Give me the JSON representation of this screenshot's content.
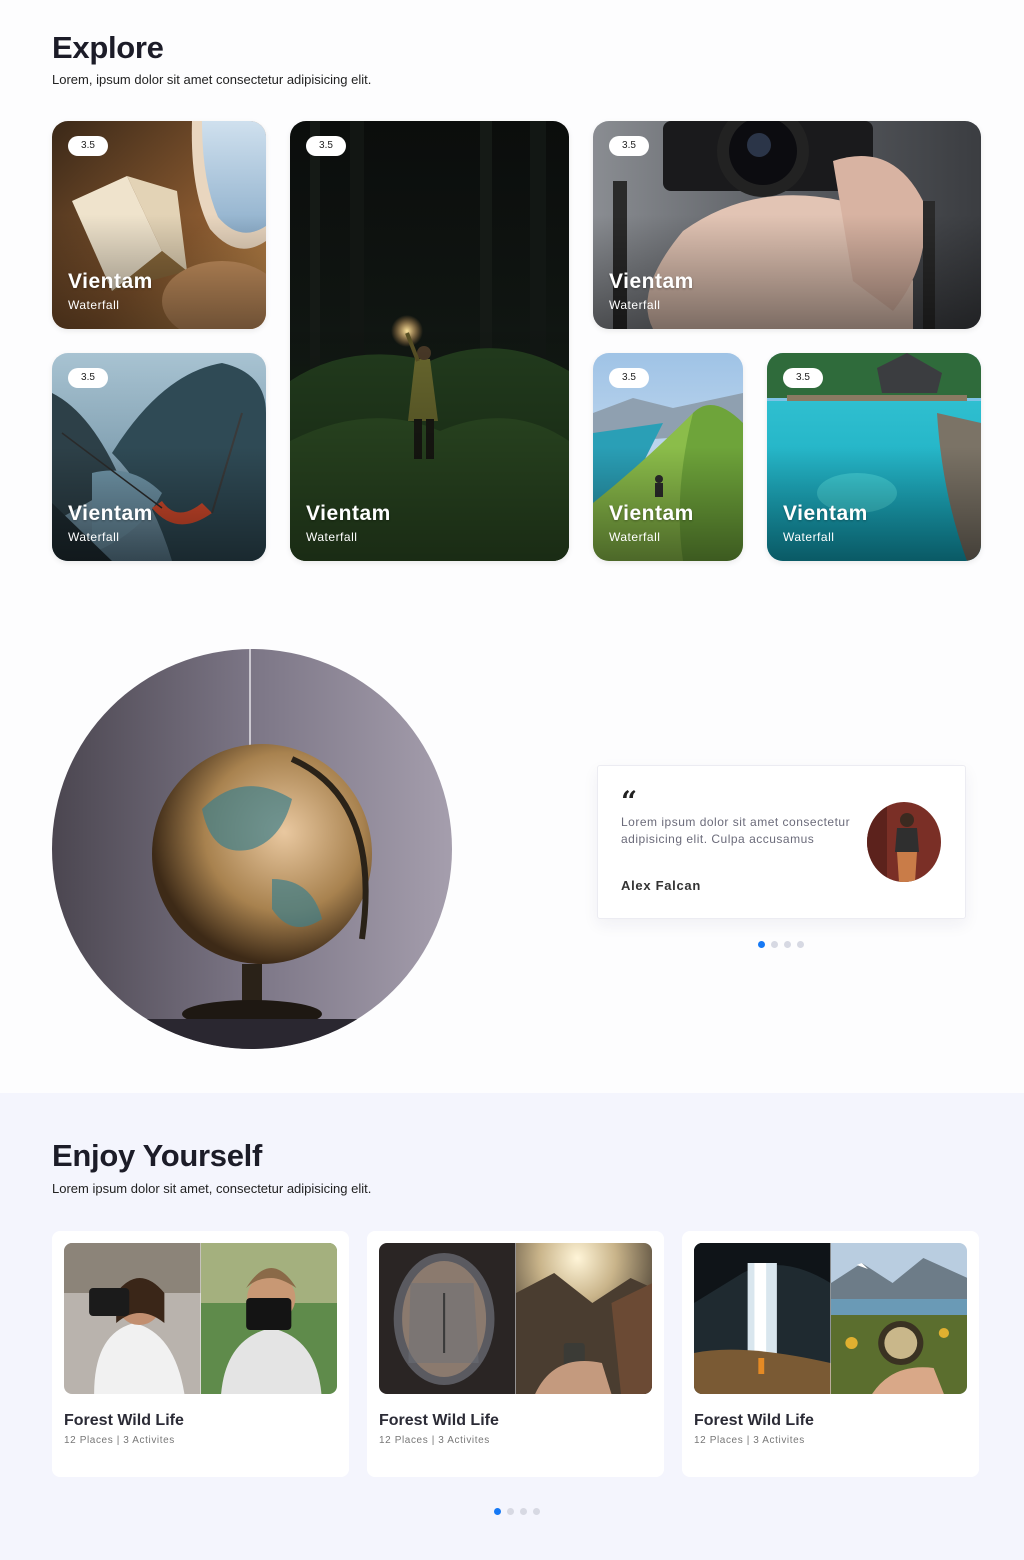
{
  "explore": {
    "title": "Explore",
    "subtitle": "Lorem, ipsum dolor sit amet consectetur adipisicing elit.",
    "cards": [
      {
        "rating": "3.5",
        "title": "Vientam",
        "subtitle": "Waterfall",
        "scene": "book-airplane-window"
      },
      {
        "rating": "3.5",
        "title": "Vientam",
        "subtitle": "Waterfall",
        "scene": "night-forest-sparkler"
      },
      {
        "rating": "3.5",
        "title": "Vientam",
        "subtitle": "Waterfall",
        "scene": "hands-camera"
      },
      {
        "rating": "3.5",
        "title": "Vientam",
        "subtitle": "Waterfall",
        "scene": "fjord-hammock"
      },
      {
        "rating": "3.5",
        "title": "Vientam",
        "subtitle": "Waterfall",
        "scene": "mountain-ridge-hiker"
      },
      {
        "rating": "3.5",
        "title": "Vientam",
        "subtitle": "Waterfall",
        "scene": "tropical-lagoon"
      }
    ]
  },
  "testimonial": {
    "quote_mark": "“",
    "text": "Lorem ipsum dolor sit amet consectetur adipisicing elit. Culpa accusamus",
    "author": "Alex Falcan",
    "image": "globe",
    "avatar": "person-red-wall",
    "dots": 4,
    "active_dot": 0
  },
  "enjoy": {
    "title": "Enjoy Yourself",
    "subtitle": "Lorem ipsum dolor sit amet, consectetur adipisicing elit.",
    "tiles": [
      {
        "title": "Forest Wild Life",
        "meta": "12 Places | 3 Activites",
        "images": [
          "woman-camera-city",
          "woman-camera-forest"
        ]
      },
      {
        "title": "Forest Wild Life",
        "meta": "12 Places | 3 Activites",
        "images": [
          "plane-window-city",
          "coffee-mountain-sunrise"
        ]
      },
      {
        "title": "Forest Wild Life",
        "meta": "12 Places | 3 Activites",
        "images": [
          "waterfall-cave-hiker",
          "compass-lake-mountains"
        ]
      }
    ],
    "dots": 4,
    "active_dot": 0
  }
}
